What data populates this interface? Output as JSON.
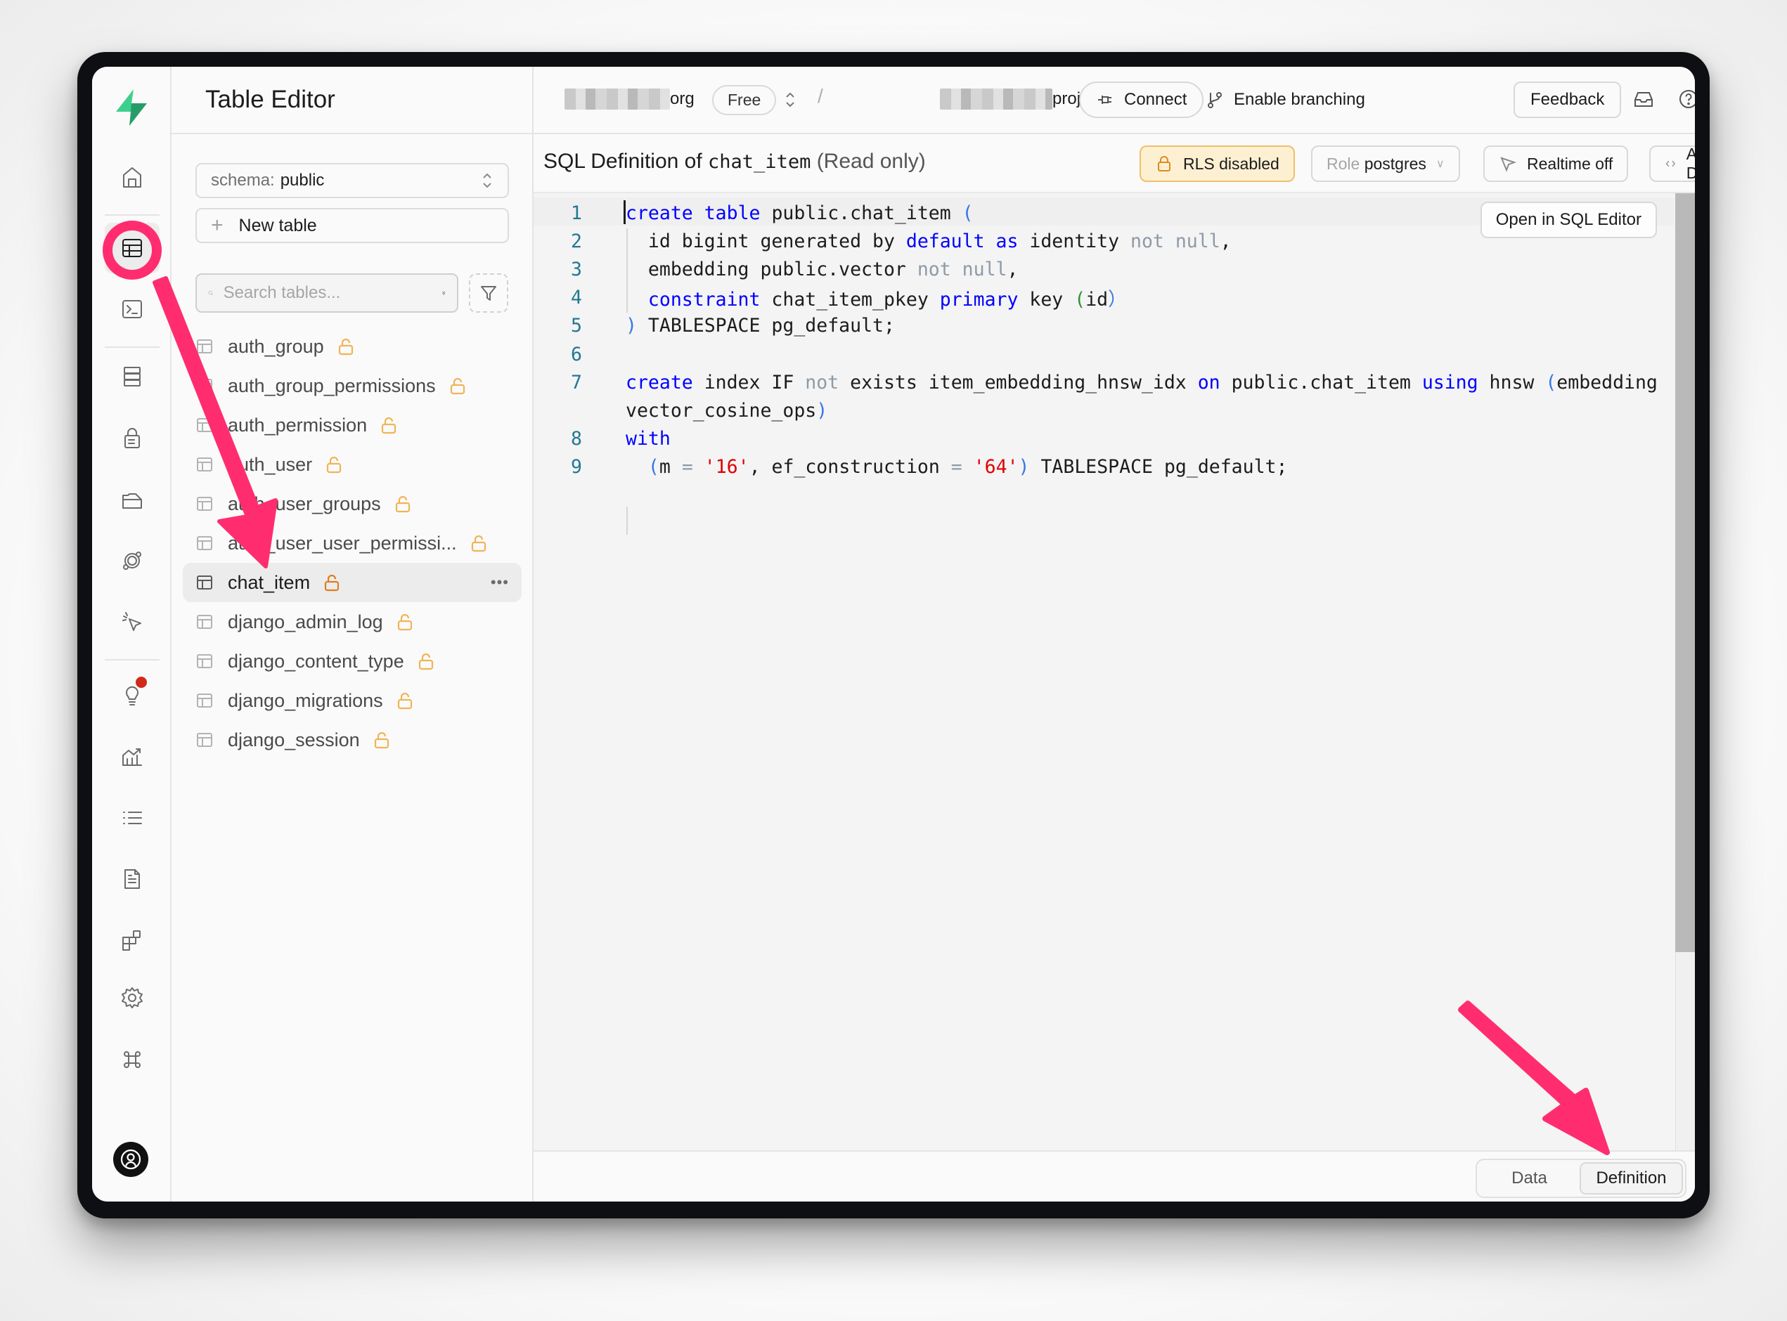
{
  "app": {
    "section_title": "Table Editor"
  },
  "rail": {
    "items": [
      {
        "name": "home-icon",
        "label": "Home"
      },
      {
        "name": "table-editor-icon",
        "label": "Table Editor",
        "active": true
      },
      {
        "name": "sql-editor-icon",
        "label": "SQL Editor"
      },
      {
        "name": "database-icon",
        "label": "Database"
      },
      {
        "name": "auth-icon",
        "label": "Authentication"
      },
      {
        "name": "storage-icon",
        "label": "Storage"
      },
      {
        "name": "edge-functions-icon",
        "label": "Edge Functions"
      },
      {
        "name": "realtime-icon",
        "label": "Realtime"
      },
      {
        "name": "advisors-icon",
        "label": "Advisors",
        "notification": true
      },
      {
        "name": "reports-icon",
        "label": "Reports"
      },
      {
        "name": "logs-icon",
        "label": "Logs"
      },
      {
        "name": "api-docs-icon",
        "label": "API Docs"
      },
      {
        "name": "integrations-icon",
        "label": "Integrations"
      },
      {
        "name": "settings-icon",
        "label": "Project Settings"
      },
      {
        "name": "command-icon",
        "label": "Commands"
      }
    ]
  },
  "sidebar": {
    "schema_label": "schema:",
    "schema_value": "public",
    "new_table_label": "New table",
    "search_placeholder": "Search tables...",
    "tables": [
      {
        "name": "auth_group"
      },
      {
        "name": "auth_group_permissions"
      },
      {
        "name": "auth_permission"
      },
      {
        "name": "auth_user"
      },
      {
        "name": "auth_user_groups"
      },
      {
        "name": "auth_user_user_permissi..."
      },
      {
        "name": "chat_item",
        "active": true
      },
      {
        "name": "django_admin_log"
      },
      {
        "name": "django_content_type"
      },
      {
        "name": "django_migrations"
      },
      {
        "name": "django_session"
      }
    ]
  },
  "header": {
    "org_suffix": "org",
    "plan_badge": "Free",
    "separator": "/",
    "project_suffix": "project",
    "connect_label": "Connect",
    "branching_label": "Enable branching",
    "feedback_label": "Feedback"
  },
  "toolbar": {
    "title_prefix": "SQL Definition of",
    "table_name": "chat_item",
    "read_only": "(Read only)",
    "rls_label": "RLS disabled",
    "role_prefix": "Role",
    "role_value": "postgres",
    "realtime_label": "Realtime off",
    "api_docs_label": "API Docs"
  },
  "editor": {
    "open_in_sql_editor_label": "Open in SQL Editor",
    "line_numbers": [
      "1",
      "2",
      "3",
      "4",
      "5",
      "6",
      "7",
      "",
      "8",
      "9"
    ],
    "lines": [
      [
        [
          "kw",
          "create"
        ],
        [
          "t",
          " "
        ],
        [
          "kw",
          "table"
        ],
        [
          "t",
          " public.chat_item "
        ],
        [
          "par",
          "("
        ]
      ],
      [
        [
          "t",
          "  id bigint generated by "
        ],
        [
          "kw",
          "default"
        ],
        [
          "t",
          " "
        ],
        [
          "kw",
          "as"
        ],
        [
          "t",
          " identity "
        ],
        [
          "gry",
          "not"
        ],
        [
          "t",
          " "
        ],
        [
          "gry",
          "null"
        ],
        [
          "t",
          ","
        ]
      ],
      [
        [
          "t",
          "  embedding public.vector "
        ],
        [
          "gry",
          "not"
        ],
        [
          "t",
          " "
        ],
        [
          "gry",
          "null"
        ],
        [
          "t",
          ","
        ]
      ],
      [
        [
          "t",
          "  "
        ],
        [
          "kw",
          "constraint"
        ],
        [
          "t",
          " chat_item_pkey "
        ],
        [
          "kw",
          "primary"
        ],
        [
          "t",
          " key "
        ],
        [
          "par2",
          "("
        ],
        [
          "t",
          "id"
        ],
        [
          "par",
          "）"
        ]
      ],
      [
        [
          "par",
          ")"
        ],
        [
          "t",
          " TABLESPACE pg_default;"
        ]
      ],
      [],
      [
        [
          "kw",
          "create"
        ],
        [
          "t",
          " index IF "
        ],
        [
          "gry",
          "not"
        ],
        [
          "t",
          " exists item_embedding_hnsw_idx "
        ],
        [
          "kw",
          "on"
        ],
        [
          "t",
          " public.chat_item "
        ],
        [
          "kw",
          "using"
        ],
        [
          "t",
          " hnsw "
        ],
        [
          "par",
          "("
        ],
        [
          "t",
          "embedding"
        ]
      ],
      [
        [
          "t",
          "vector_cosine_ops"
        ],
        [
          "par",
          ")"
        ]
      ],
      [
        [
          "kw",
          "with"
        ]
      ],
      [
        [
          "t",
          "  "
        ],
        [
          "par",
          "("
        ],
        [
          "t",
          "m "
        ],
        [
          "gry",
          "="
        ],
        [
          "t",
          " "
        ],
        [
          "str",
          "'16'"
        ],
        [
          "t",
          ", ef_construction "
        ],
        [
          "gry",
          "="
        ],
        [
          "t",
          " "
        ],
        [
          "str",
          "'64'"
        ],
        [
          "par",
          ")"
        ],
        [
          "t",
          " TABLESPACE pg_default;"
        ]
      ]
    ]
  },
  "bottom_tabs": {
    "data_label": "Data",
    "definition_label": "Definition",
    "active": "Definition"
  },
  "colors": {
    "brand_green": "#3ecf8e",
    "annotation_pink": "#ff2d6f",
    "rls_warning_bg": "#fdf0d2",
    "lock_orange": "#f0b455",
    "sql_keyword": "#0000ff",
    "sql_string": "#e00000"
  }
}
